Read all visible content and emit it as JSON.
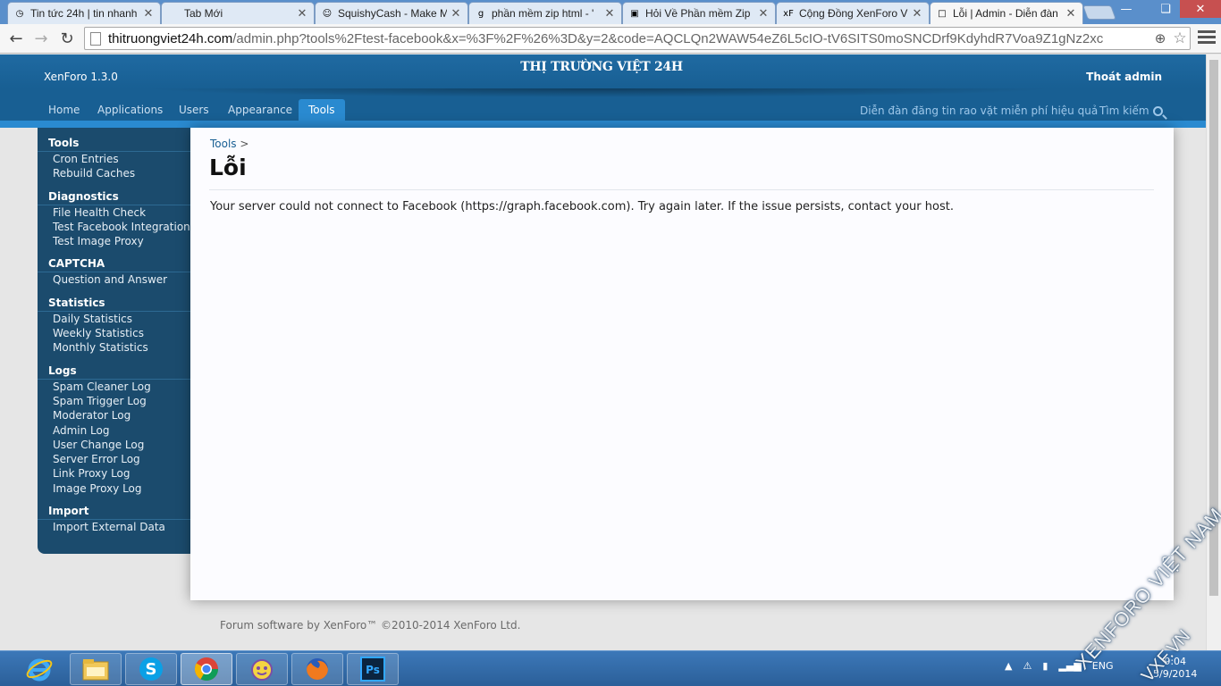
{
  "browser": {
    "tabs": [
      {
        "label": "Tin tức 24h | tin nhanh",
        "favicon": "clock-icon",
        "active": false
      },
      {
        "label": "Tab Mới",
        "favicon": "",
        "active": false
      },
      {
        "label": "SquishyCash - Make M",
        "favicon": "squishy-icon",
        "active": false
      },
      {
        "label": "phần mềm zip html - '",
        "favicon": "google-icon",
        "active": false
      },
      {
        "label": "Hỏi Về Phần mềm Zip",
        "favicon": "forum-icon",
        "active": false
      },
      {
        "label": "Cộng Đồng XenForo V",
        "favicon": "xf-icon",
        "active": false
      },
      {
        "label": "Lỗi | Admin - Diễn đàn",
        "favicon": "page-icon",
        "active": true
      }
    ],
    "url_domain": "thitruongviet24h.com",
    "url_path": "/admin.php?tools%2Ftest-facebook&x=%3F%2F%26%3D&y=2&code=AQCLQn2WAW54eZ6L5cIO-tV6SITS0moSNCDrf9KdyhdR7Voa9Z1gNz2xc"
  },
  "header": {
    "version": "XenForo 1.3.0",
    "logo": "THỊ TRƯỜNG VIỆT 24H",
    "logout": "Thoát admin",
    "tagline": "Diễn đàn đăng tin rao vặt miễn phí hiệu quả",
    "search_label": "Tìm kiếm"
  },
  "nav": [
    "Home",
    "Applications",
    "Users",
    "Appearance",
    "Tools"
  ],
  "nav_active": "Tools",
  "sidebar": [
    {
      "title": "Tools",
      "items": [
        "Cron Entries",
        "Rebuild Caches"
      ]
    },
    {
      "title": "Diagnostics",
      "items": [
        "File Health Check",
        "Test Facebook Integration",
        "Test Image Proxy"
      ]
    },
    {
      "title": "CAPTCHA",
      "items": [
        "Question and Answer"
      ]
    },
    {
      "title": "Statistics",
      "items": [
        "Daily Statistics",
        "Weekly Statistics",
        "Monthly Statistics"
      ]
    },
    {
      "title": "Logs",
      "items": [
        "Spam Cleaner Log",
        "Spam Trigger Log",
        "Moderator Log",
        "Admin Log",
        "User Change Log",
        "Server Error Log",
        "Link Proxy Log",
        "Image Proxy Log"
      ]
    },
    {
      "title": "Import",
      "items": [
        "Import External Data"
      ]
    }
  ],
  "content": {
    "breadcrumb": "Tools",
    "breadcrumb_sep": ">",
    "title": "Lỗi",
    "message": "Your server could not connect to Facebook (https://graph.facebook.com). Try again later. If the issue persists, contact your host."
  },
  "footer": "Forum software by XenForo™ ©2010-2014 XenForo Ltd.",
  "taskbar": {
    "apps": [
      "internet-explorer-icon",
      "file-explorer-icon",
      "skype-icon",
      "chrome-icon",
      "yahoo-messenger-icon",
      "firefox-icon",
      "photoshop-icon"
    ],
    "tray_lang": "ENG",
    "time": "9:04",
    "date": "5/9/2014"
  },
  "watermark": {
    "line1": "XENFORO VIỆT NAM",
    "line2": "VXF.VN"
  },
  "colors": {
    "header": "#185f93",
    "accent": "#2a8ad0",
    "sidebar": "#1b4b6d",
    "taskbar": "#2b5f99"
  }
}
